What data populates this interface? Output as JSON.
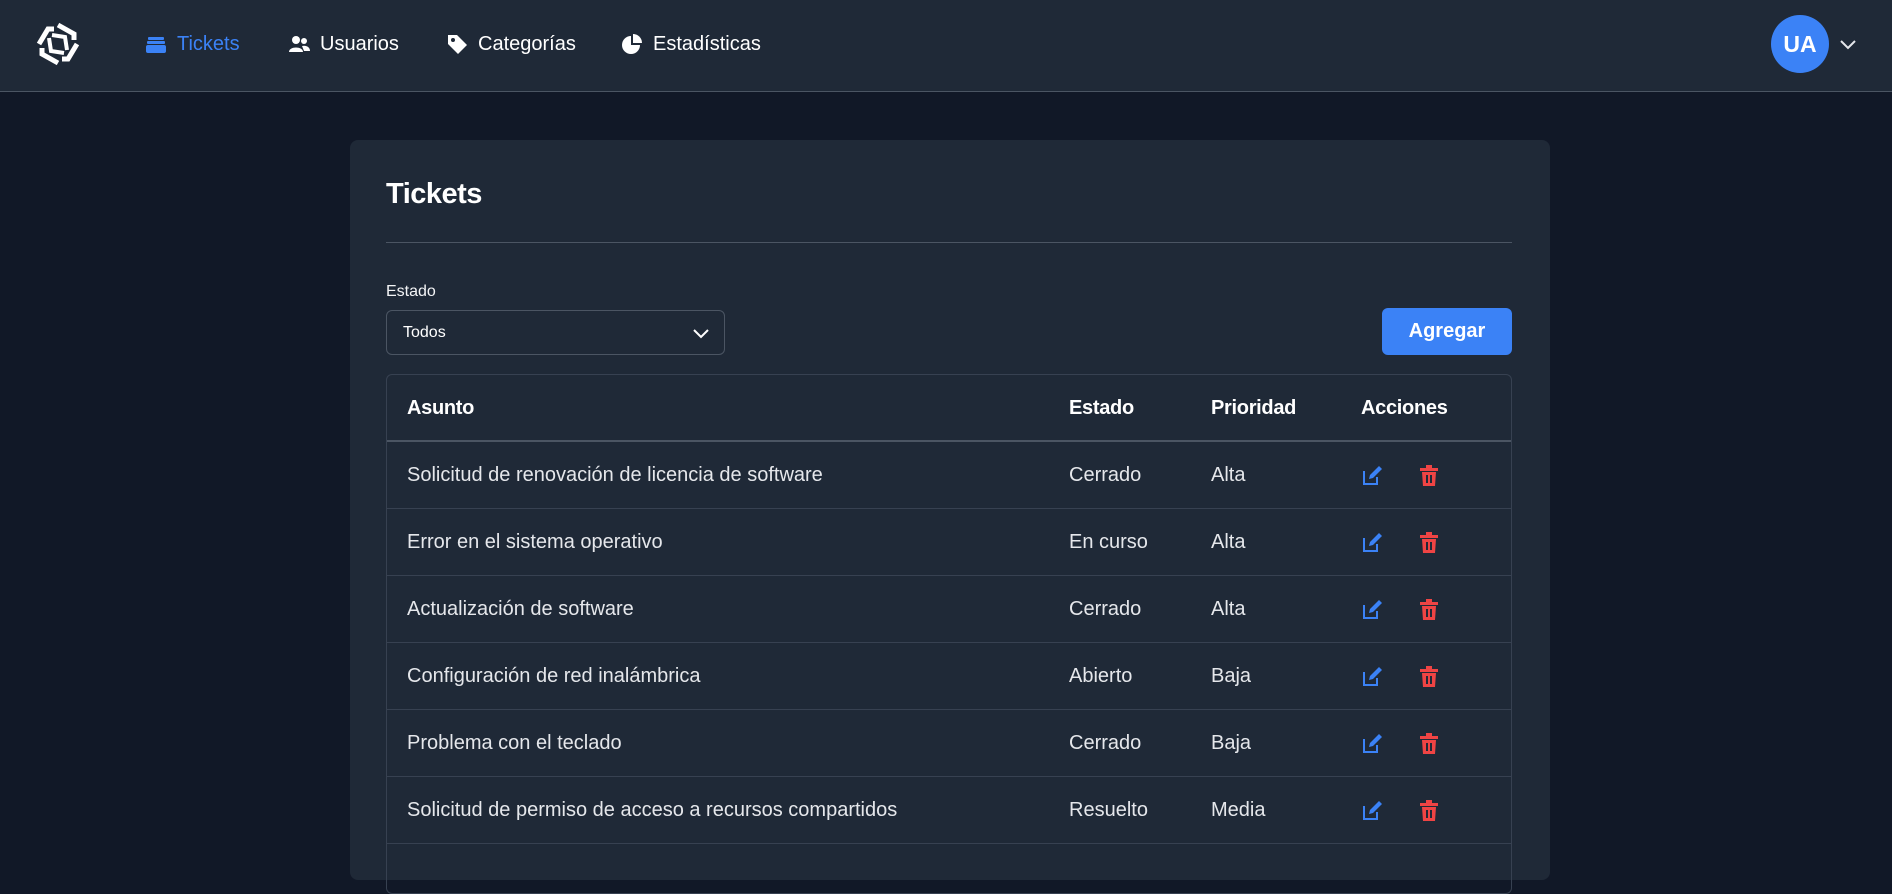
{
  "navbar": {
    "logo_icon": "hexagon-logo-icon",
    "items": [
      {
        "label": "Tickets",
        "icon": "inbox-icon",
        "active": true
      },
      {
        "label": "Usuarios",
        "icon": "users-icon",
        "active": false
      },
      {
        "label": "Categorías",
        "icon": "tag-icon",
        "active": false
      },
      {
        "label": "Estadísticas",
        "icon": "chart-pie-icon",
        "active": false
      }
    ],
    "user_initials": "UA"
  },
  "page": {
    "title": "Tickets",
    "filter": {
      "label": "Estado",
      "selected": "Todos"
    },
    "add_label": "Agregar"
  },
  "table": {
    "headers": {
      "subject": "Asunto",
      "state": "Estado",
      "priority": "Prioridad",
      "actions": "Acciones"
    },
    "rows": [
      {
        "subject": "Solicitud de renovación de licencia de software",
        "state": "Cerrado",
        "priority": "Alta"
      },
      {
        "subject": "Error en el sistema operativo",
        "state": "En curso",
        "priority": "Alta"
      },
      {
        "subject": "Actualización de software",
        "state": "Cerrado",
        "priority": "Alta"
      },
      {
        "subject": "Configuración de red inalámbrica",
        "state": "Abierto",
        "priority": "Baja"
      },
      {
        "subject": "Problema con el teclado",
        "state": "Cerrado",
        "priority": "Baja"
      },
      {
        "subject": "Solicitud de permiso de acceso a recursos compartidos",
        "state": "Resuelto",
        "priority": "Media"
      }
    ]
  },
  "colors": {
    "accent": "#3b82f6",
    "danger": "#ef4444",
    "navbar_bg": "#1f2937",
    "page_bg": "#111827"
  }
}
